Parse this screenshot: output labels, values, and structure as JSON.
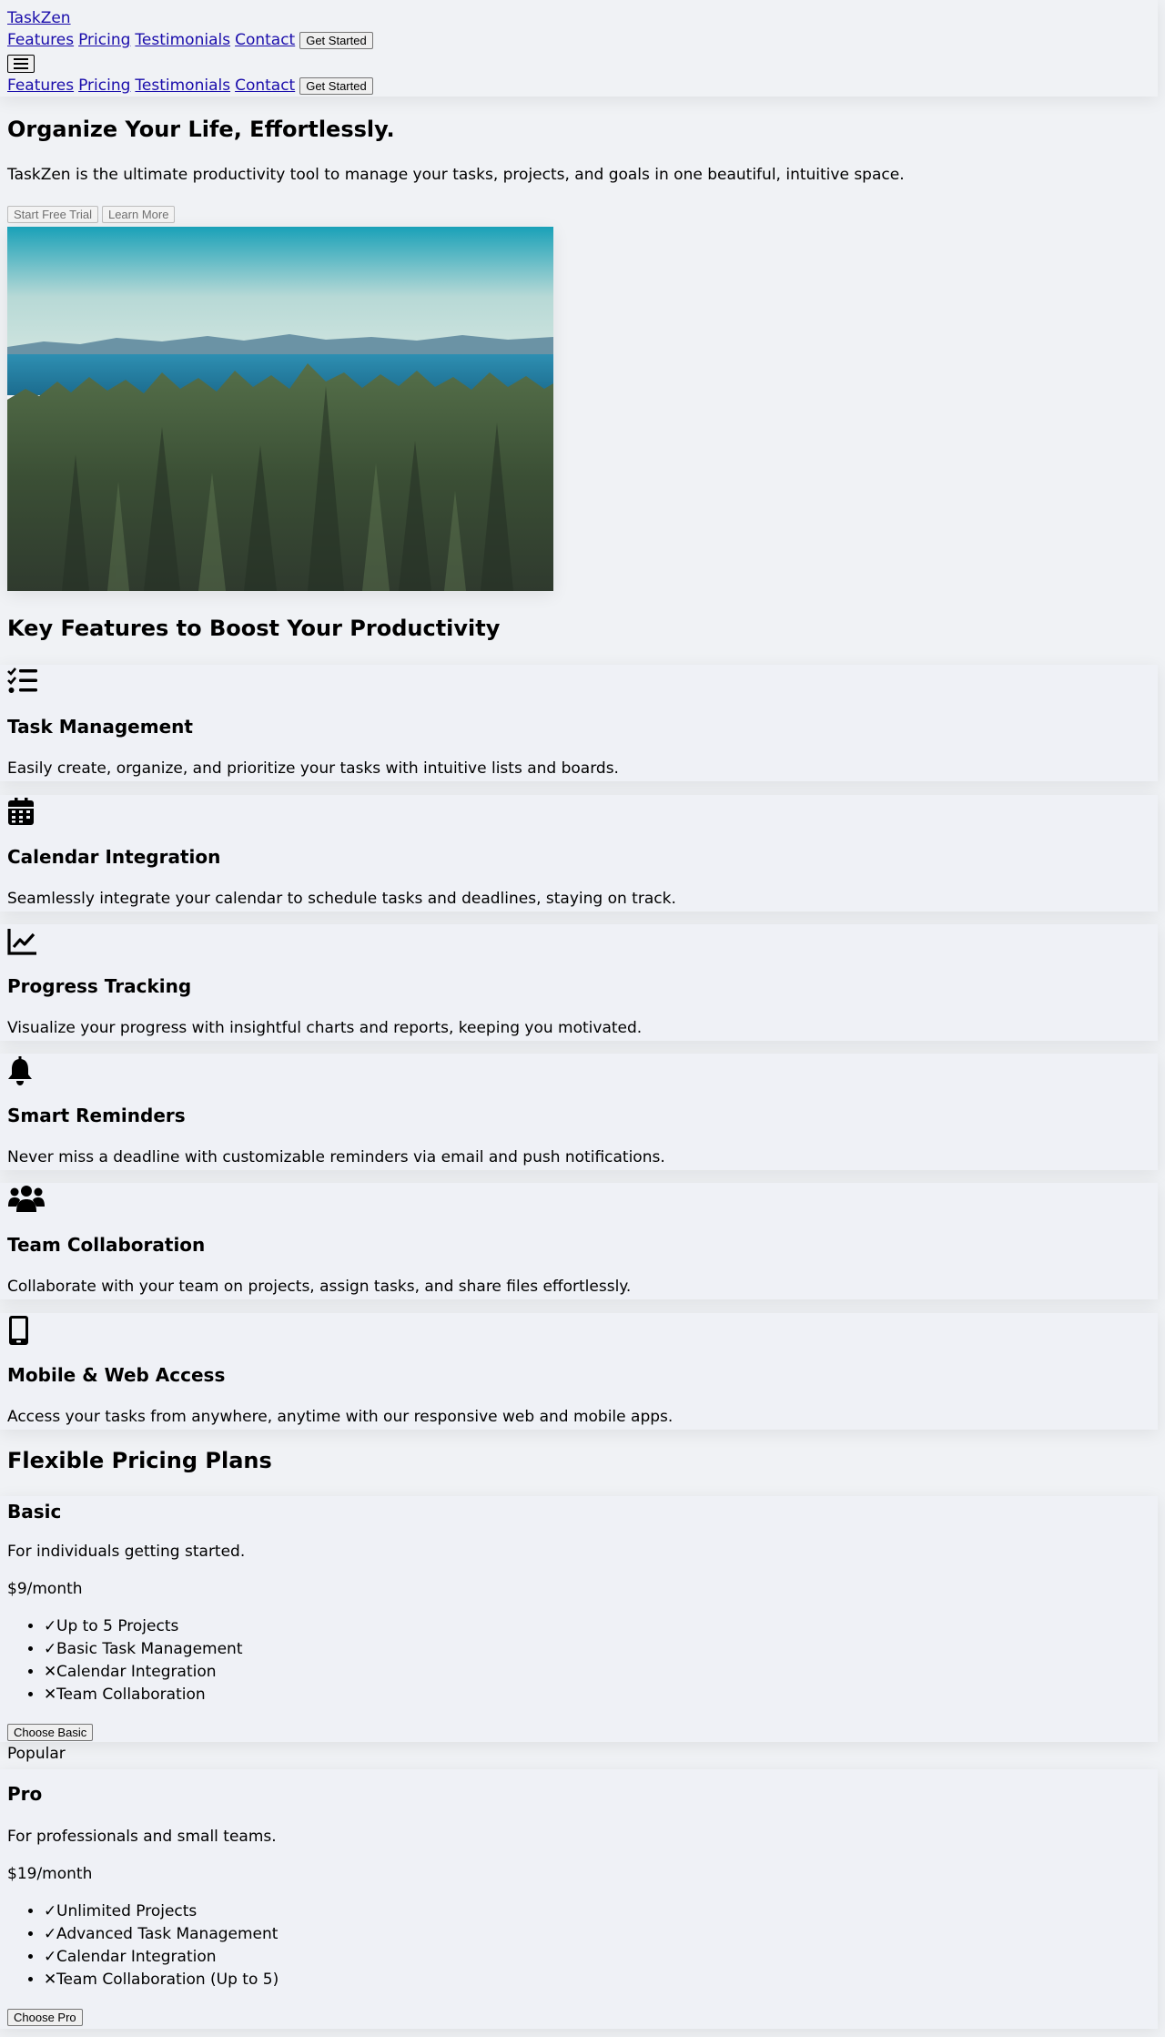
{
  "header": {
    "brand": "TaskZen",
    "nav": [
      "Features",
      "Pricing",
      "Testimonials",
      "Contact"
    ],
    "cta": "Get Started"
  },
  "hero": {
    "title": "Organize Your Life, Effortlessly.",
    "subtitle": "TaskZen is the ultimate productivity tool to manage your tasks, projects, and goals in one beautiful, intuitive space.",
    "primary_button": "Start Free Trial",
    "secondary_button": "Learn More"
  },
  "features": {
    "title": "Key Features to Boost Your Productivity",
    "items": [
      {
        "icon": "list-check-icon",
        "title": "Task Management",
        "text": "Easily create, organize, and prioritize your tasks with intuitive lists and boards."
      },
      {
        "icon": "calendar-icon",
        "title": "Calendar Integration",
        "text": "Seamlessly integrate your calendar to schedule tasks and deadlines, staying on track."
      },
      {
        "icon": "chart-line-icon",
        "title": "Progress Tracking",
        "text": "Visualize your progress with insightful charts and reports, keeping you motivated."
      },
      {
        "icon": "bell-icon",
        "title": "Smart Reminders",
        "text": "Never miss a deadline with customizable reminders via email and push notifications."
      },
      {
        "icon": "users-icon",
        "title": "Team Collaboration",
        "text": "Collaborate with your team on projects, assign tasks, and share files effortlessly."
      },
      {
        "icon": "mobile-icon",
        "title": "Mobile & Web Access",
        "text": "Access your tasks from anywhere, anytime with our responsive web and mobile apps."
      }
    ]
  },
  "pricing": {
    "title": "Flexible Pricing Plans",
    "plans": [
      {
        "name": "Basic",
        "desc": "For individuals getting started.",
        "price": "$9/month",
        "features": [
          {
            "text": "Up to 5 Projects",
            "included": true
          },
          {
            "text": "Basic Task Management",
            "included": true
          },
          {
            "text": "Calendar Integration",
            "included": false
          },
          {
            "text": "Team Collaboration",
            "included": false
          }
        ],
        "button": "Choose Basic"
      },
      {
        "badge": "Popular",
        "name": "Pro",
        "desc": "For professionals and small teams.",
        "price": "$19/month",
        "features": [
          {
            "text": "Unlimited Projects",
            "included": true
          },
          {
            "text": "Advanced Task Management",
            "included": true
          },
          {
            "text": "Calendar Integration",
            "included": true
          },
          {
            "text": "Team Collaboration (Up to 5)",
            "included": false
          }
        ],
        "button": "Choose Pro"
      }
    ]
  },
  "icons": {
    "check": "✓",
    "cross": "✕"
  },
  "colors": {
    "page_bg": "#f0f2f5",
    "card_bg": "#eff1f6",
    "link": "#1a0dab"
  }
}
